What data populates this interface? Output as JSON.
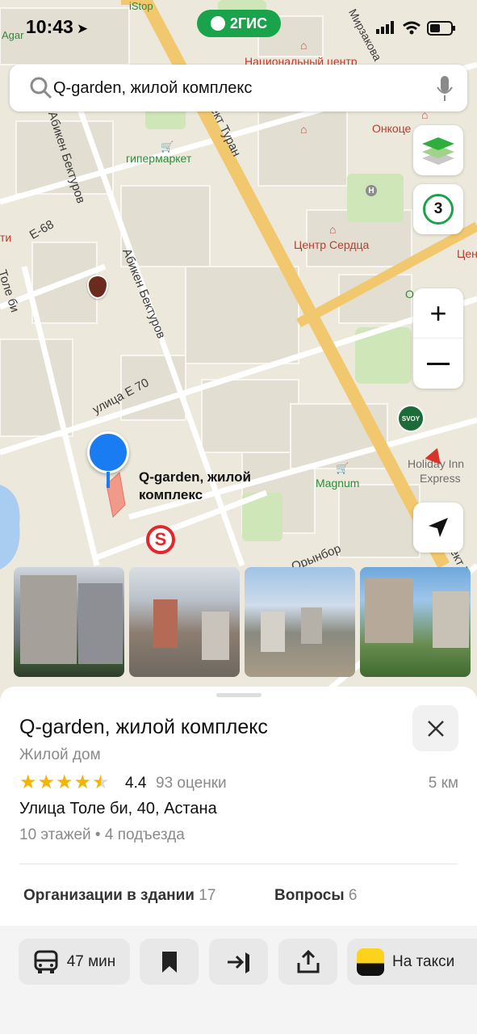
{
  "status_bar": {
    "time": "10:43"
  },
  "brand": {
    "name": "2ГИС"
  },
  "search": {
    "query": "Q-garden, жилой комплекс"
  },
  "map": {
    "traffic_level": "3",
    "pin_label": [
      "Q-garden, жилой",
      "комплекс"
    ],
    "labels": {
      "istop": "iStop",
      "agar": "Agar",
      "national_center": "Национальный центр",
      "onco": "Онкоце",
      "hypermarket": "гипермаркет",
      "heart_center": "Центр Сердца",
      "cen": "Цен",
      "o": "О",
      "ti": "ти",
      "magnum": "Magnum",
      "holiday": [
        "Holiday Inn",
        "Express"
      ],
      "svoy": "SVOY"
    },
    "streets": {
      "turan": "проспект Туран",
      "mirzakova": "Мирзакова",
      "abiken1": "Абикен Бектуров",
      "abiken2": "Абикен Бектуров",
      "e68": "Е-68",
      "toleby": "Толе би",
      "e70": "улица Е 70",
      "orynbor": "Орынбор",
      "pekt": "пект Т"
    }
  },
  "place": {
    "title": "Q-garden, жилой комплекс",
    "category": "Жилой дом",
    "rating": "4.4",
    "rating_value": 4.4,
    "rating_count": "93 оценки",
    "distance": "5 км",
    "address": "Улица Толе би, 40, Астана",
    "details": "10 этажей • 4 подъезда"
  },
  "tabs": {
    "orgs_label": "Организации в здании",
    "orgs_count": "17",
    "questions_label": "Вопросы",
    "questions_count": "6"
  },
  "actions": {
    "route_time": "47 мин",
    "taxi": "На такси"
  },
  "colors": {
    "brand_green": "#19a34a",
    "pin_blue": "#1a7cf2",
    "star": "#f4b400"
  }
}
